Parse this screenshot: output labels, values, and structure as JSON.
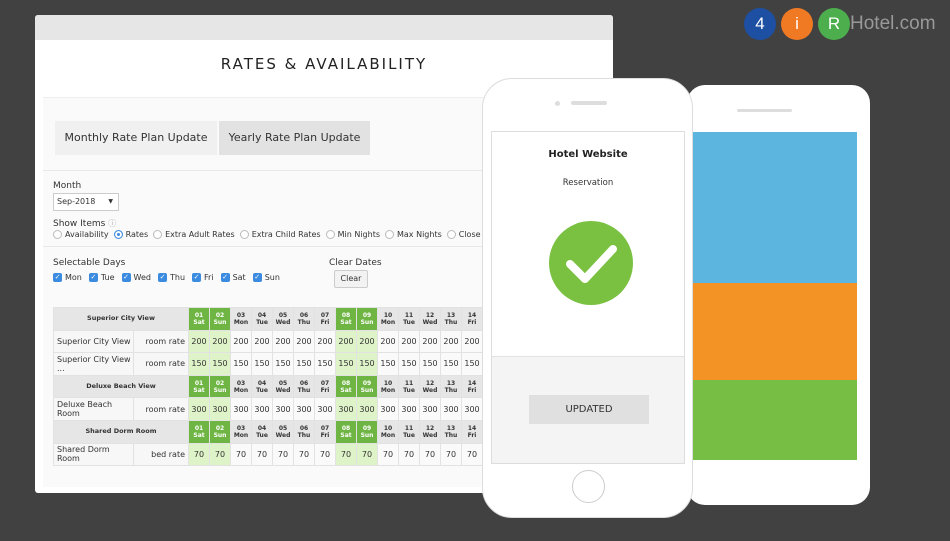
{
  "logo": {
    "c1": "4",
    "c2": "i",
    "c3": "R",
    "text": "Hotel.com",
    "colors": [
      "#1d4fa3",
      "#f07a24",
      "#4cae4c"
    ]
  },
  "desktop": {
    "title": "RATES & AVAILABILITY",
    "tabs": [
      {
        "label": "Monthly Rate Plan Update",
        "active": true
      },
      {
        "label": "Yearly Rate Plan Update",
        "active": false
      }
    ],
    "month_label": "Month",
    "month_value": "Sep-2018",
    "show_items_label": "Show Items",
    "show_items": [
      {
        "label": "Availability",
        "checked": false
      },
      {
        "label": "Rates",
        "checked": true
      },
      {
        "label": "Extra Adult Rates",
        "checked": false
      },
      {
        "label": "Extra Child Rates",
        "checked": false
      },
      {
        "label": "Min Nights",
        "checked": false
      },
      {
        "label": "Max Nights",
        "checked": false
      },
      {
        "label": "Close to Arrival",
        "checked": false
      }
    ],
    "selectable_days_label": "Selectable Days",
    "days": [
      "Mon",
      "Tue",
      "Wed",
      "Thu",
      "Fri",
      "Sat",
      "Sun"
    ],
    "clear_dates_label": "Clear Dates",
    "clear_button": "Clear",
    "dates": [
      [
        "01",
        "Sat"
      ],
      [
        "02",
        "Sun"
      ],
      [
        "03",
        "Mon"
      ],
      [
        "04",
        "Tue"
      ],
      [
        "05",
        "Wed"
      ],
      [
        "06",
        "Thu"
      ],
      [
        "07",
        "Fri"
      ],
      [
        "08",
        "Sat"
      ],
      [
        "09",
        "Sun"
      ],
      [
        "10",
        "Mon"
      ],
      [
        "11",
        "Tue"
      ],
      [
        "12",
        "Wed"
      ],
      [
        "13",
        "Thu"
      ],
      [
        "14",
        "Fri"
      ]
    ],
    "weekend_color": "#6fb544",
    "groups": [
      {
        "name": "Superior City View",
        "rows": [
          {
            "room": "Superior City View",
            "type": "room rate",
            "value": "200"
          },
          {
            "room": "Superior City View ...",
            "type": "room rate",
            "value": "150"
          }
        ]
      },
      {
        "name": "Deluxe Beach View",
        "rows": [
          {
            "room": "Deluxe Beach Room",
            "type": "room rate",
            "value": "300"
          }
        ]
      },
      {
        "name": "Shared Dorm Room",
        "rows": [
          {
            "room": "Shared Dorm Room",
            "type": "bed rate",
            "value": "70"
          }
        ]
      }
    ]
  },
  "phone": {
    "title": "Hotel Website",
    "subtitle": "Reservation",
    "button": "UPDATED",
    "check_color": "#7ac142"
  },
  "android": {
    "colors": [
      "#5bb5df",
      "#f39325",
      "#76bf44"
    ]
  }
}
